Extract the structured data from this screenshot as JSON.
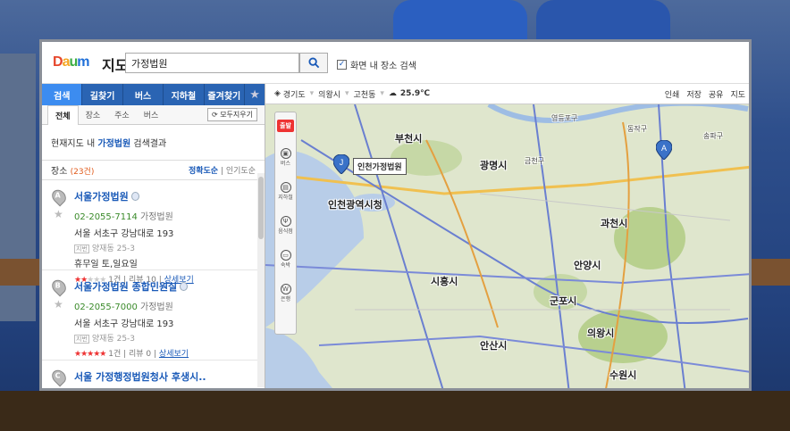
{
  "app": {
    "logo": "Daum",
    "title": "지도"
  },
  "search": {
    "value": "가정법원",
    "checkbox_label": "화면 내 장소 검색",
    "checkbox_checked": true
  },
  "nav": {
    "items": [
      "검색",
      "길찾기",
      "버스",
      "지하철",
      "즐겨찾기"
    ],
    "active": "검색"
  },
  "subtabs": {
    "items": [
      "전체",
      "장소",
      "주소",
      "버스"
    ],
    "active": "전체",
    "clear_label": "모두지우기"
  },
  "result_message": {
    "prefix": "현재지도 내",
    "keyword": "가정법원",
    "suffix": "검색결과"
  },
  "places_header": {
    "label": "장소",
    "count": "(23건)",
    "sort_options": [
      "정확도순",
      "인기도순"
    ],
    "sort_active": "정확도순"
  },
  "results": [
    {
      "marker": "A",
      "name": "서울가정법원",
      "phone": "02-2055-7114",
      "category": "가정법원",
      "address": "서울 서초구 강남대로 193",
      "jibun_label": "지번",
      "jibun": "양재동 25-3",
      "hours_label": "휴무일",
      "hours": "토,일요일",
      "stars": 2,
      "review_count": "1건",
      "review_label": "리뷰 10",
      "detail_label": "상세보기"
    },
    {
      "marker": "B",
      "name": "서울가정법원",
      "name_suffix": "종합민원실",
      "phone": "02-2055-7000",
      "category": "가정법원",
      "address": "서울 서초구 강남대로 193",
      "jibun_label": "지번",
      "jibun": "양재동 25-3",
      "stars": 5,
      "review_count": "1건",
      "review_label": "리뷰 0",
      "detail_label": "상세보기"
    },
    {
      "marker": "C",
      "name": "서울 가정행정법원청사 후생시.."
    }
  ],
  "mapbar": {
    "region1": "경기도",
    "region2": "의왕시",
    "region3": "고천동",
    "temperature": "25.9℃",
    "actions": [
      "인쇄",
      "저장",
      "공유",
      "지도"
    ]
  },
  "map_tools": [
    {
      "name": "출발",
      "label": "출발"
    },
    {
      "name": "bus",
      "label": "버스"
    },
    {
      "name": "subway",
      "label": "지하철"
    },
    {
      "name": "food",
      "label": "음식점"
    },
    {
      "name": "hotel",
      "label": "숙박"
    },
    {
      "name": "more",
      "label": "은행"
    }
  ],
  "map_labels": [
    "부천시",
    "광명시",
    "인천광역시청",
    "과천시",
    "안양시",
    "시흥시",
    "군포시",
    "의왕시",
    "안산시",
    "수원시",
    "영등포구",
    "동작구",
    "금천구",
    "송파구"
  ],
  "map_callout": "인천가정법원",
  "map_pins": [
    "J",
    "A"
  ],
  "colors": {
    "accent": "#2a64b3",
    "active_tab": "#3c8cf0",
    "link": "#1a5ab8",
    "phone": "#3a8a2a",
    "stars": "#e33333"
  }
}
